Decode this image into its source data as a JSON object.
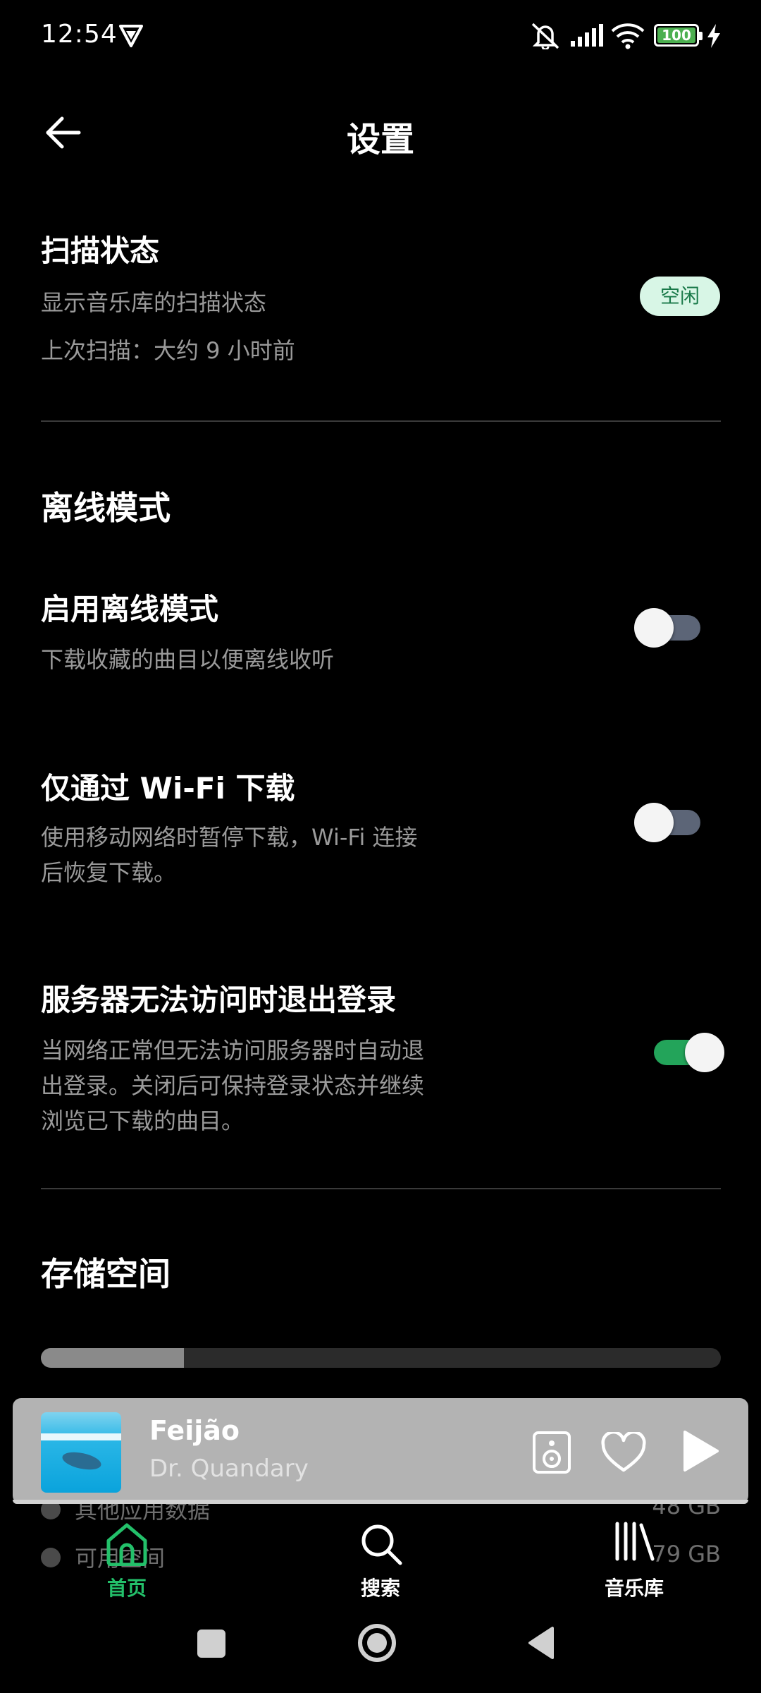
{
  "status_bar": {
    "time": "12:54",
    "battery_level": "100",
    "icons": [
      "vpn-icon",
      "mute-icon",
      "signal-icon",
      "wifi-icon",
      "battery-icon",
      "charging-icon"
    ]
  },
  "header": {
    "title": "设置",
    "back_icon": "arrow-left-icon"
  },
  "scan_status": {
    "title": "扫描状态",
    "description": "显示音乐库的扫描状态",
    "last_scan": "上次扫描：大约 9 小时前",
    "badge": "空闲"
  },
  "offline_mode": {
    "section_title": "离线模式",
    "settings": [
      {
        "title": "启用离线模式",
        "description": "下载收藏的曲目以便离线收听",
        "enabled": false
      },
      {
        "title": "仅通过 Wi-Fi 下载",
        "description_line1": "使用移动网络时暂停下载，Wi-Fi 连接",
        "description_line2": "后恢复下载。",
        "enabled": false
      },
      {
        "title": "服务器无法访问时退出登录",
        "description_line1": "当网络正常但无法访问服务器时自动退",
        "description_line2": "出登录。关闭后可保持登录状态并继续",
        "description_line3": "浏览已下载的曲目。",
        "enabled": true
      }
    ]
  },
  "storage": {
    "section_title": "存储空间",
    "used_fraction": 0.21,
    "legend": [
      {
        "label": "其他应用数据",
        "value": "48 GB"
      },
      {
        "label": "可用空间",
        "value": "79 GB"
      }
    ]
  },
  "mini_player": {
    "song": "Feijão",
    "artist": "Dr. Quandary",
    "icons": [
      "speaker-icon",
      "heart-icon",
      "play-icon"
    ]
  },
  "bottom_nav": [
    {
      "label": "首页",
      "icon": "home-icon",
      "active": true
    },
    {
      "label": "搜索",
      "icon": "search-icon",
      "active": false
    },
    {
      "label": "音乐库",
      "icon": "library-icon",
      "active": false
    }
  ],
  "colors": {
    "accent": "#23c06a",
    "badge_bg": "#d8f6e6",
    "toggle_off": "#5c6577",
    "toggle_on": "#23a45a"
  }
}
